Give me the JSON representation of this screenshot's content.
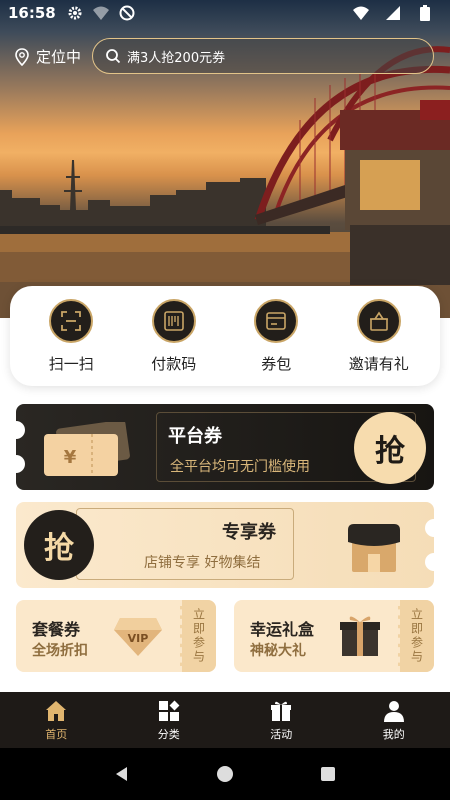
{
  "status_bar": {
    "time": "16:58"
  },
  "header": {
    "location": "定位中",
    "search_placeholder": "满3人抢200元券"
  },
  "quick_actions": [
    {
      "label": "扫一扫",
      "icon": "scan-icon"
    },
    {
      "label": "付款码",
      "icon": "barcode-icon"
    },
    {
      "label": "券包",
      "icon": "wallet-icon"
    },
    {
      "label": "邀请有礼",
      "icon": "gift-basket-icon"
    }
  ],
  "platform_coupon": {
    "title": "平台券",
    "subtitle": "全平台均可无门槛使用",
    "grab": "抢",
    "ticket_symbol": "¥"
  },
  "exclusive_coupon": {
    "title": "专享券",
    "subtitle": "店铺专享 好物集结",
    "grab": "抢"
  },
  "meal_coupon": {
    "title": "套餐券",
    "subtitle": "全场折扣",
    "badge": "VIP",
    "action": "立即参与"
  },
  "lucky_gift": {
    "title": "幸运礼盒",
    "subtitle": "神秘大礼",
    "action": "立即参与"
  },
  "bottom_nav": [
    {
      "label": "首页",
      "icon": "home-icon",
      "active": true
    },
    {
      "label": "分类",
      "icon": "category-icon",
      "active": false
    },
    {
      "label": "活动",
      "icon": "gift-icon",
      "active": false
    },
    {
      "label": "我的",
      "icon": "person-icon",
      "active": false
    }
  ],
  "colors": {
    "gold": "#c9a566",
    "dark": "#1e1a17",
    "cream": "#fbe8cb",
    "accent_text": "#e0b56f"
  }
}
